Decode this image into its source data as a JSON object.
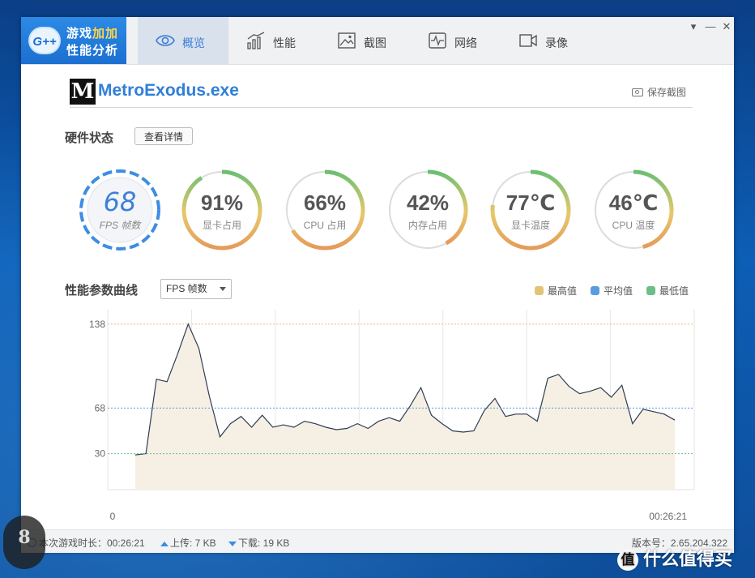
{
  "app": {
    "logo_badge": "G++",
    "logo_line1_a": "游戏",
    "logo_line1_b": "加加",
    "logo_line2": "性能分析",
    "window_controls": [
      "▾",
      "—",
      "✕"
    ]
  },
  "tabs": [
    {
      "label": "概览",
      "icon": "eye-icon",
      "active": true
    },
    {
      "label": "性能",
      "icon": "bar-chart-icon",
      "active": false
    },
    {
      "label": "截图",
      "icon": "image-icon",
      "active": false
    },
    {
      "label": "网络",
      "icon": "pulse-icon",
      "active": false
    },
    {
      "label": "录像",
      "icon": "video-icon",
      "active": false
    }
  ],
  "game": {
    "icon_letter": "M",
    "name": "MetroExodus.exe",
    "save_screenshot": "保存截图"
  },
  "hardware": {
    "title": "硬件状态",
    "details_button": "查看详情",
    "gauges": [
      {
        "value": "68",
        "label": "FPS 帧数",
        "percent": null
      },
      {
        "value": "91%",
        "label": "显卡占用",
        "percent": 91
      },
      {
        "value": "66%",
        "label": "CPU 占用",
        "percent": 66
      },
      {
        "value": "42%",
        "label": "内存占用",
        "percent": 42
      },
      {
        "value": "77℃",
        "label": "显卡温度",
        "percent": 77
      },
      {
        "value": "46℃",
        "label": "CPU 温度",
        "percent": 46
      }
    ],
    "gauge_colors": {
      "green": "#6bbf73",
      "yellow": "#e8c86a",
      "orange": "#e59b5a",
      "track": "#dcdcdc",
      "fps_blue": "#3d8de2"
    }
  },
  "curve": {
    "title": "性能参数曲线",
    "select_value": "FPS 帧数",
    "legend": [
      {
        "label": "最高值",
        "color": "#e3c477"
      },
      {
        "label": "平均值",
        "color": "#5b9be0"
      },
      {
        "label": "最低值",
        "color": "#6bbf86"
      }
    ],
    "x_start": "0",
    "x_end": "00:26:21"
  },
  "chart_data": {
    "type": "area",
    "series": [
      {
        "values": [
          29,
          30,
          92,
          90,
          113,
          138,
          118,
          78,
          44,
          55,
          61,
          52,
          62,
          52,
          54,
          52,
          57,
          55,
          52,
          50,
          51,
          55,
          51,
          57,
          60,
          57,
          70,
          85,
          62,
          55,
          49,
          48,
          49,
          66,
          76,
          61,
          63,
          63,
          57,
          93,
          96,
          86,
          80,
          82,
          85,
          77,
          87,
          55,
          67,
          65,
          63,
          58
        ]
      }
    ],
    "reference_lines": {
      "max": 138,
      "avg": 68,
      "min": 30
    },
    "y_ticks": [
      138,
      68,
      30
    ],
    "ylim": [
      0,
      150
    ],
    "grid": true
  },
  "status": {
    "duration": "本次游戏时长：00:26:21",
    "upload": "上传: 7 KB",
    "download": "下载: 19 KB",
    "version": "版本号：2.65.204.322"
  },
  "watermark": {
    "right_text": "什么值得买",
    "right_glyph": "值",
    "left_text": "8"
  }
}
